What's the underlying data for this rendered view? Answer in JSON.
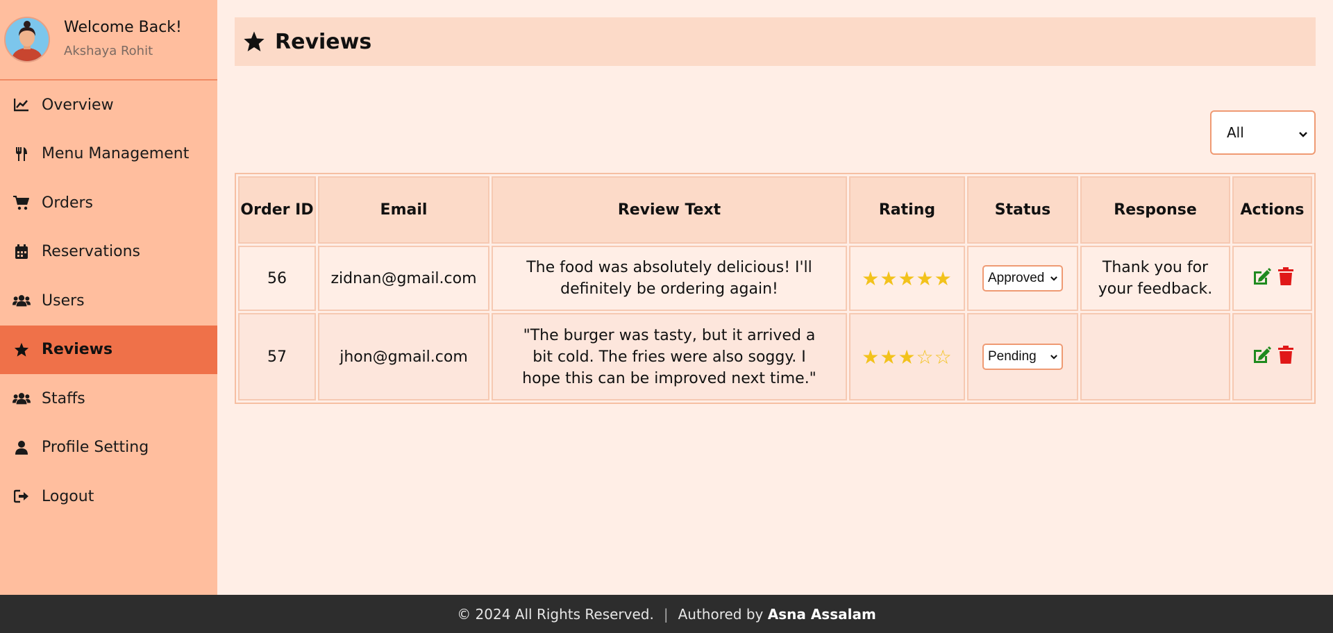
{
  "profile": {
    "greeting": "Welcome Back!",
    "name": "Akshaya Rohit"
  },
  "sidebar": {
    "items": [
      {
        "label": "Overview",
        "icon": "chart-line-icon"
      },
      {
        "label": "Menu Management",
        "icon": "utensils-icon"
      },
      {
        "label": "Orders",
        "icon": "cart-icon"
      },
      {
        "label": "Reservations",
        "icon": "calendar-icon"
      },
      {
        "label": "Users",
        "icon": "users-icon"
      },
      {
        "label": "Reviews",
        "icon": "star-icon",
        "active": true
      },
      {
        "label": "Staffs",
        "icon": "users-icon"
      },
      {
        "label": "Profile Setting",
        "icon": "user-icon"
      },
      {
        "label": "Logout",
        "icon": "logout-icon"
      }
    ]
  },
  "page": {
    "title": "Reviews"
  },
  "filter": {
    "selected": "All"
  },
  "table": {
    "headers": [
      "Order ID",
      "Email",
      "Review Text",
      "Rating",
      "Status",
      "Response",
      "Actions"
    ],
    "rows": [
      {
        "order_id": "56",
        "email": "zidnan@gmail.com",
        "review": "The food was absolutely delicious! I'll definitely be ordering again!",
        "rating_stars": "★★★★★",
        "rating": 5,
        "status": "Approved",
        "response": "Thank you for your feedback."
      },
      {
        "order_id": "57",
        "email": "jhon@gmail.com",
        "review": "\"The burger was tasty, but it arrived a bit cold. The fries were also soggy. I hope this can be improved next time.\"",
        "rating_stars": "★★★☆☆",
        "rating": 3,
        "status": "Pending",
        "response": ""
      }
    ]
  },
  "footer": {
    "copyright": "© 2024 All Rights Reserved.",
    "separator": "|",
    "authored_prefix": "Authored by",
    "author": "Asna Assalam"
  },
  "colors": {
    "sidebar_bg": "#ffbe9e",
    "active_bg": "#ef7149",
    "page_bg": "#ffeee6",
    "star": "#f2c21b",
    "edit": "#1f8a1f",
    "delete": "#e01818",
    "footer_bg": "#2d2d2d"
  }
}
